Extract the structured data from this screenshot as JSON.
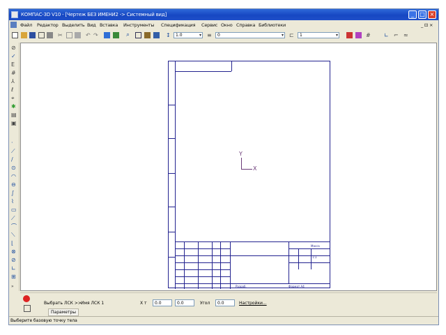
{
  "titlebar": {
    "title": "КОМПАС-3D V10 - [Чертеж БЕЗ ИМЕНИ2 -> Системный вид]",
    "colors": {
      "accent": "#1647c2",
      "close": "#d9412a"
    }
  },
  "window_buttons": {
    "minimize": "_",
    "maximize": "□",
    "close": "×"
  },
  "menubar": {
    "items": [
      "Файл",
      "Редактор",
      "Выделить",
      "Вид",
      "Вставка",
      "Инструменты",
      "Спецификация",
      "Сервис",
      "Окно",
      "Справка",
      "Библиотеки"
    ],
    "right_controls": "_ ⊡ ×"
  },
  "toolbar": {
    "combo_step": "1.0",
    "combo_layer": "0",
    "combo_style": "1"
  },
  "drawing": {
    "axis_x": "X",
    "axis_y": "Y",
    "title_label_changed": "Разраб.",
    "title_label_format": "Формат A4",
    "sheet_count": "1:1",
    "scale_label": "Масса"
  },
  "properties_panel": {
    "select_label": "Выбрать ЛСК >>",
    "name_label": "Имя ЛСК 1",
    "x_label": "X т",
    "x_value": "0.0",
    "y_value": "0.0",
    "angle_label": "Угол",
    "angle_value": "0.0",
    "more_label": "Настройки...",
    "tab_label": "Параметры"
  },
  "status": {
    "text": "Выберите базовую точку тела"
  }
}
